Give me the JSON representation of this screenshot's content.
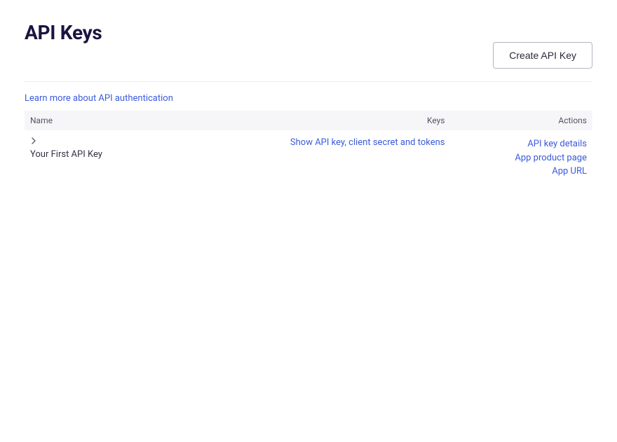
{
  "header": {
    "title": "API Keys",
    "create_button": "Create API Key"
  },
  "learn_link": "Learn more about API authentication",
  "table": {
    "columns": {
      "name": "Name",
      "keys": "Keys",
      "actions": "Actions"
    },
    "rows": [
      {
        "name": "Your First API Key",
        "show_link": "Show API key, client secret and tokens",
        "actions": {
          "details": "API key details",
          "product_page": "App product page",
          "app_url": "App URL"
        }
      }
    ]
  }
}
